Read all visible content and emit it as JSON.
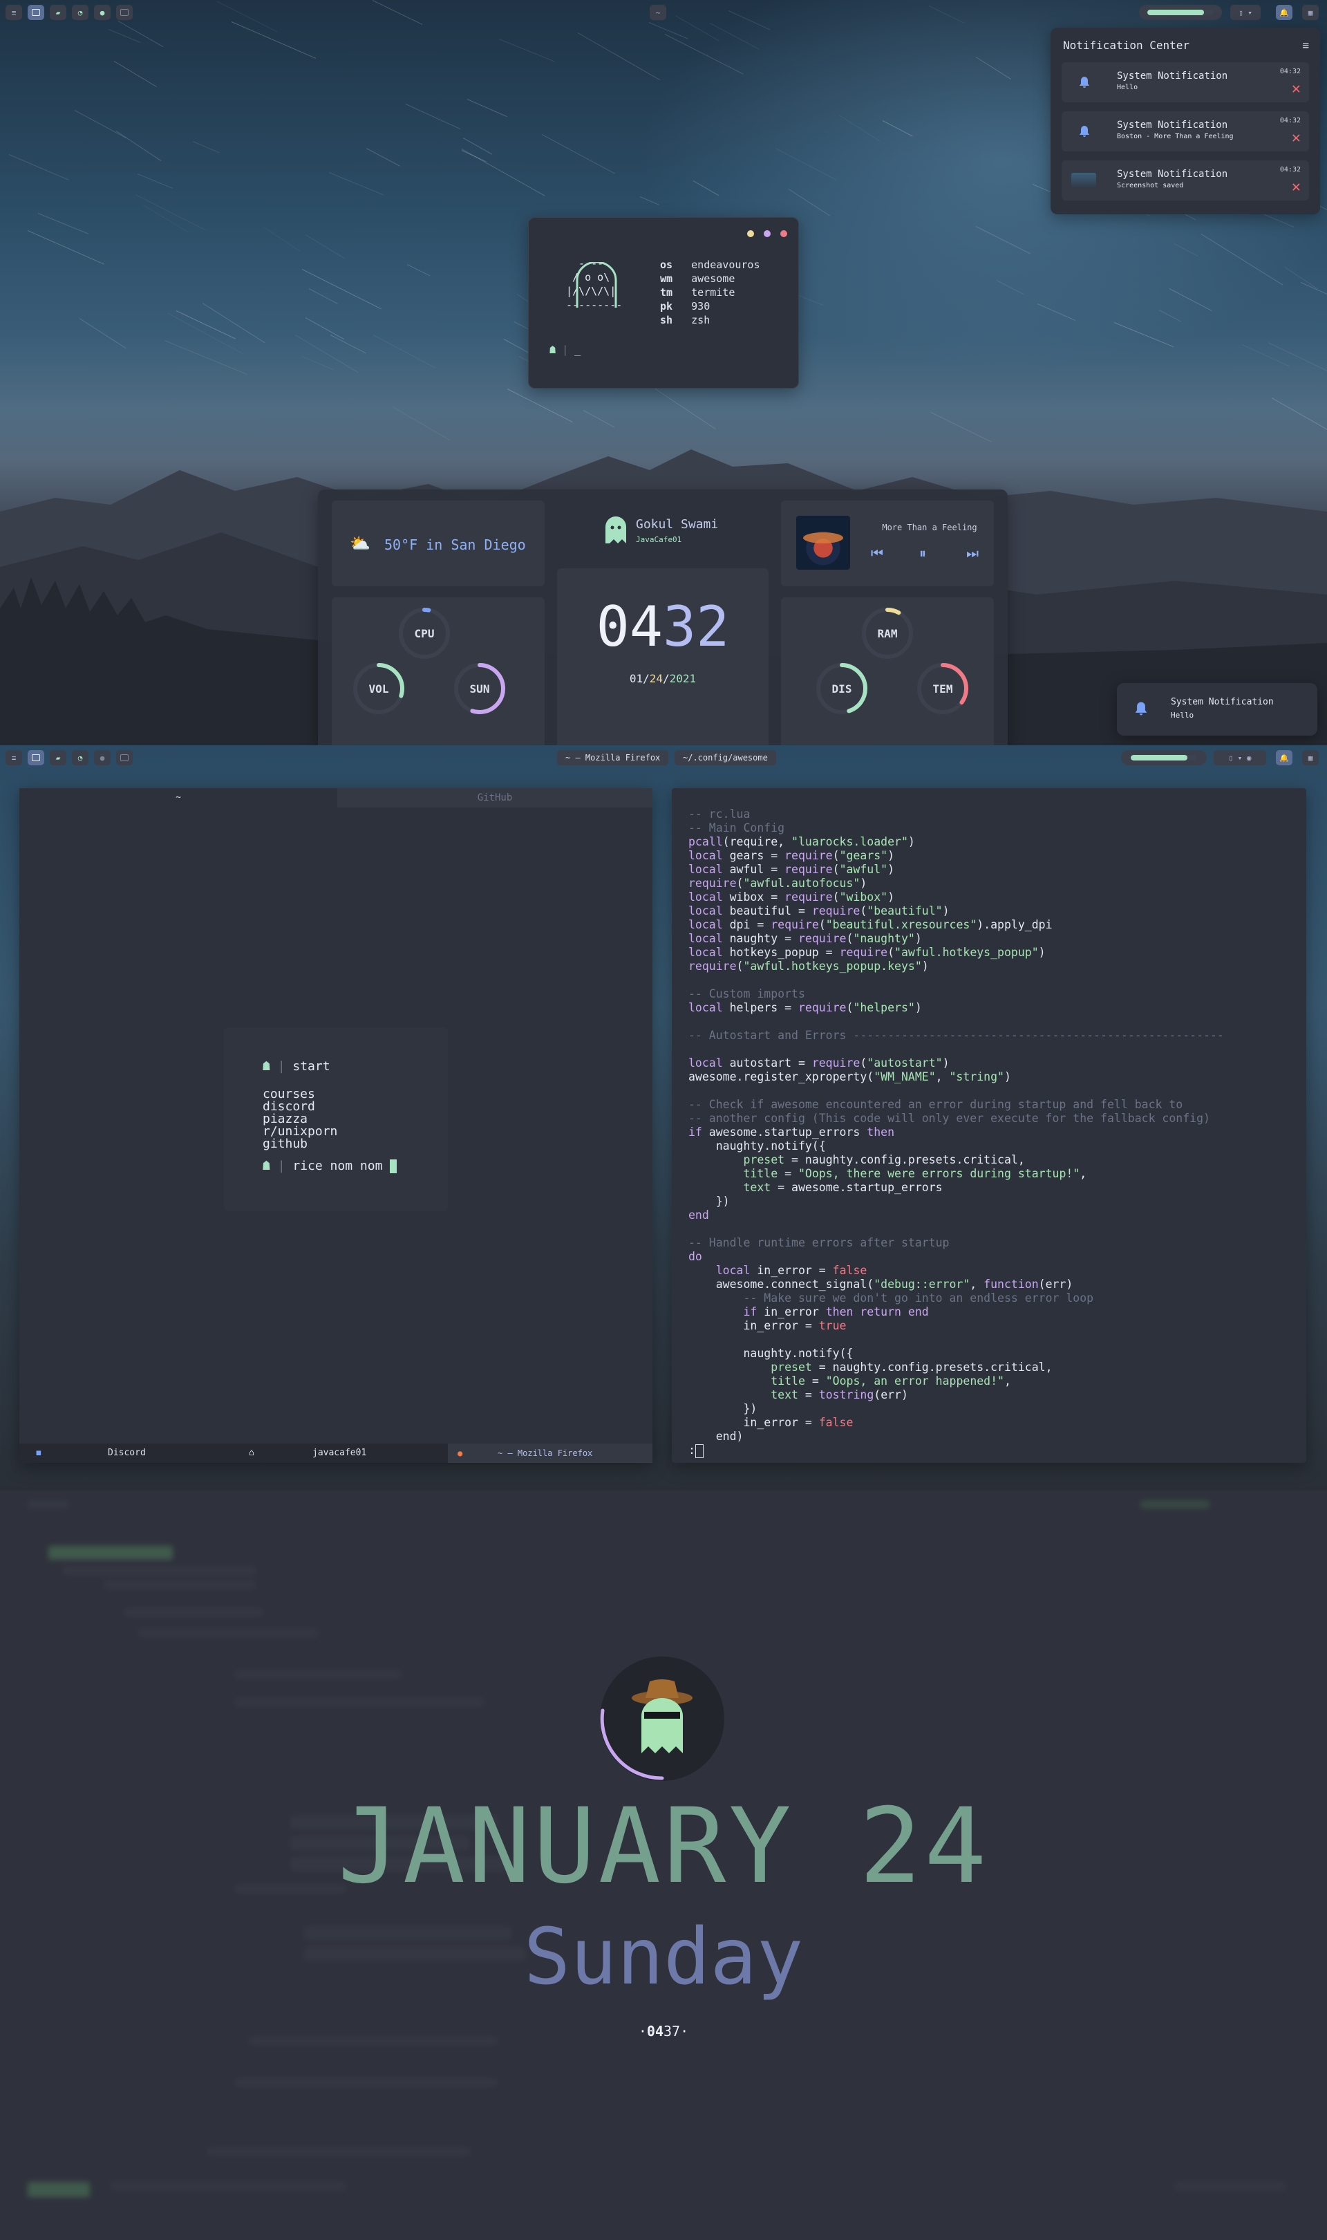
{
  "desktop1": {
    "launcher": {
      "tray_toggle": "≡",
      "tag_labels": [
        "▤",
        "▣",
        "◆",
        "◔",
        "●",
        "▢"
      ]
    },
    "center_pill": "~",
    "battery_level": 0.85,
    "notification_center": {
      "title": "Notification Center",
      "items": [
        {
          "title": "System Notification",
          "body": "Hello",
          "time": "04:32",
          "icon": "bell-icon"
        },
        {
          "title": "System Notification",
          "body": "Boston - More Than a Feeling",
          "time": "04:32",
          "icon": "bell-icon"
        },
        {
          "title": "System Notification",
          "body": "Screenshot saved",
          "time": "04:32",
          "icon": "screenshot-thumb"
        }
      ]
    },
    "fetch": {
      "rows": [
        {
          "k": "os",
          "v": "endeavouros"
        },
        {
          "k": "wm",
          "v": "awesome"
        },
        {
          "k": "tm",
          "v": "termite"
        },
        {
          "k": "pk",
          "v": "930"
        },
        {
          "k": "sh",
          "v": "zsh"
        }
      ],
      "prompt": "_"
    },
    "dashboard": {
      "weather": "50°F in San Diego",
      "user_name": "Gokul Swami",
      "user_handle": "JavaCafe01",
      "song": "More Than a Feeling",
      "clock_hour": "04",
      "clock_min": "32",
      "date_month": "01",
      "date_day": "24",
      "date_year": "2021",
      "gauges": [
        {
          "label": "CPU",
          "value": 0.03,
          "color": "#7aa2f7"
        },
        {
          "label": "VOL",
          "value": 0.3,
          "color": "#a7e3c3"
        },
        {
          "label": "SUN",
          "value": 0.55,
          "color": "#c9a6f0"
        },
        {
          "label": "RAM",
          "value": 0.08,
          "color": "#f0dc9a"
        },
        {
          "label": "DIS",
          "value": 0.45,
          "color": "#a7e3c3"
        },
        {
          "label": "TEM",
          "value": 0.35,
          "color": "#f07b86"
        }
      ]
    },
    "popup": {
      "title": "System Notification",
      "body": "Hello"
    }
  },
  "desktop2": {
    "task_firefox": "~ — Mozilla Firefox",
    "task_awesome": "~/.config/awesome",
    "battery_level": 0.85,
    "browser": {
      "tab_active": "~",
      "tab_inactive": "GitHub",
      "start_label": "start",
      "links": [
        "courses",
        "discord",
        "piazza",
        "r/unixporn",
        "github"
      ],
      "search_text": "rice nom nom",
      "tasks": [
        "Discord",
        "javacafe01",
        "~ — Mozilla Firefox"
      ]
    },
    "code_prompt": ":"
  },
  "lock": {
    "month_day": "JANUARY 24",
    "weekday": "Sunday",
    "time_hour": "04",
    "time_min": "37",
    "time_prefix": "·",
    "time_suffix": "·"
  },
  "colors": {
    "accent": "#7aa2f7",
    "green": "#a7e3c3",
    "purple": "#c9a6f0",
    "red": "#f07b86",
    "bg": "#2d313b"
  }
}
